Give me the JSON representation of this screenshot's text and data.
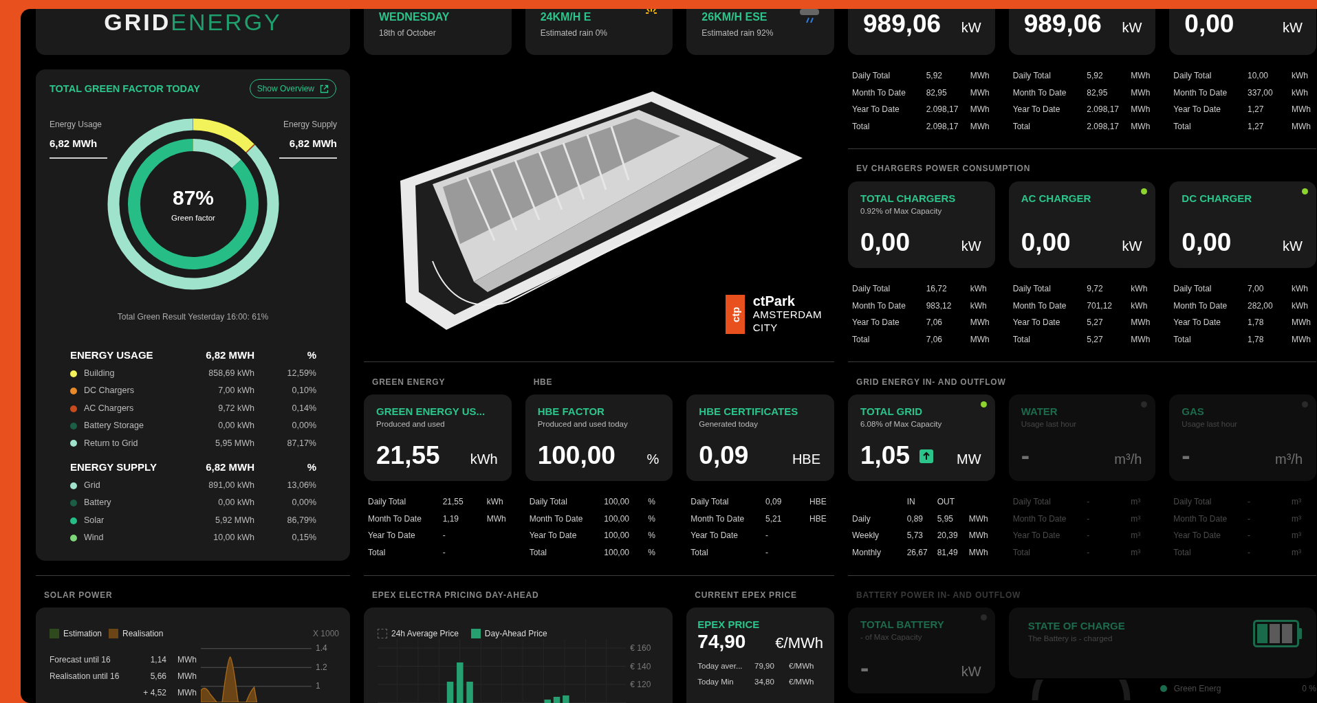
{
  "logo": {
    "part1": "GRID",
    "part2": "ENERGY"
  },
  "green_factor": {
    "title": "TOTAL GREEN FACTOR TODAY",
    "button": "Show Overview",
    "usage_label": "Energy Usage",
    "usage_value": "6,82 MWh",
    "supply_label": "Energy Supply",
    "supply_value": "6,82 MWh",
    "percent": "87%",
    "percent_label": "Green factor",
    "footnote": "Total Green Result Yesterday 16:00: 61%",
    "usage": {
      "heading": "ENERGY USAGE",
      "total": "6,82 MWH",
      "percent_heading": "%",
      "items": [
        {
          "name": "Building",
          "value": "858,69 kWh",
          "percent": "12,59%",
          "color": "#f2f25a"
        },
        {
          "name": "DC Chargers",
          "value": "7,00 kWh",
          "percent": "0,10%",
          "color": "#e88a2a"
        },
        {
          "name": "AC Chargers",
          "value": "9,72 kWh",
          "percent": "0,14%",
          "color": "#c84b1e"
        },
        {
          "name": "Battery Storage",
          "value": "0,00 kWh",
          "percent": "0,00%",
          "color": "#1a5e45"
        },
        {
          "name": "Return to Grid",
          "value": "5,95 MWh",
          "percent": "87,17%",
          "color": "#a0e3cc"
        }
      ]
    },
    "supply": {
      "heading": "ENERGY SUPPLY",
      "total": "6,82 MWH",
      "percent_heading": "%",
      "items": [
        {
          "name": "Grid",
          "value": "891,00 kWh",
          "percent": "13,06%",
          "color": "#a0e3cc"
        },
        {
          "name": "Battery",
          "value": "0,00 kWh",
          "percent": "0,00%",
          "color": "#1a5e45"
        },
        {
          "name": "Solar",
          "value": "5,92 MWh",
          "percent": "86,79%",
          "color": "#26bd87"
        },
        {
          "name": "Wind",
          "value": "10,00 kWh",
          "percent": "0,15%",
          "color": "#7ed67a"
        }
      ]
    }
  },
  "solar": {
    "title": "SOLAR POWER",
    "legend": [
      {
        "label": "Estimation",
        "color": "#2f4a1c"
      },
      {
        "label": "Realisation",
        "color": "#6b4516"
      }
    ],
    "scale": "X 1000",
    "ticks": [
      "1.4",
      "1.2",
      "1"
    ],
    "rows": [
      {
        "label": "Forecast until 16",
        "value": "1,14",
        "unit": "MWh"
      },
      {
        "label": "Realisation until 16",
        "value": "5,66",
        "unit": "MWh"
      },
      {
        "value": "+ 4,52",
        "unit": "MWh"
      }
    ]
  },
  "weather": [
    {
      "kind": "date",
      "title": "WEDNESDAY",
      "subtitle": "18th of October"
    },
    {
      "kind": "sun",
      "title": "24KM/H E",
      "subtitle": "Estimated rain 0%"
    },
    {
      "kind": "rain",
      "title": "26KM/H ESE",
      "subtitle": "Estimated rain 92%"
    }
  ],
  "building": {
    "mark": "ctp",
    "name": "ctPark",
    "lines": [
      "AMSTERDAM",
      "CITY"
    ]
  },
  "top_meters": [
    {
      "value": "989,06",
      "unit": "kW",
      "stats": [
        {
          "label": "Daily Total",
          "value": "5,92",
          "unit": "MWh"
        },
        {
          "label": "Month To Date",
          "value": "82,95",
          "unit": "MWh"
        },
        {
          "label": "Year To Date",
          "value": "2.098,17",
          "unit": "MWh"
        },
        {
          "label": "Total",
          "value": "2.098,17",
          "unit": "MWh"
        }
      ]
    },
    {
      "value": "989,06",
      "unit": "kW",
      "stats": [
        {
          "label": "Daily Total",
          "value": "5,92",
          "unit": "MWh"
        },
        {
          "label": "Month To Date",
          "value": "82,95",
          "unit": "MWh"
        },
        {
          "label": "Year To Date",
          "value": "2.098,17",
          "unit": "MWh"
        },
        {
          "label": "Total",
          "value": "2.098,17",
          "unit": "MWh"
        }
      ]
    },
    {
      "value": "0,00",
      "unit": "kW",
      "stats": [
        {
          "label": "Daily Total",
          "value": "10,00",
          "unit": "kWh"
        },
        {
          "label": "Month To Date",
          "value": "337,00",
          "unit": "kWh"
        },
        {
          "label": "Year To Date",
          "value": "1,27",
          "unit": "MWh"
        },
        {
          "label": "Total",
          "value": "1,27",
          "unit": "MWh"
        }
      ]
    }
  ],
  "ev_chargers": {
    "title": "EV CHARGERS POWER CONSUMPTION",
    "cards": [
      {
        "title": "TOTAL CHARGERS",
        "subtitle": "0.92% of Max Capacity",
        "value": "0,00",
        "unit": "kW",
        "stats": [
          {
            "label": "Daily Total",
            "value": "16,72",
            "unit": "kWh"
          },
          {
            "label": "Month To Date",
            "value": "983,12",
            "unit": "kWh"
          },
          {
            "label": "Year To Date",
            "value": "7,06",
            "unit": "MWh"
          },
          {
            "label": "Total",
            "value": "7,06",
            "unit": "MWh"
          }
        ]
      },
      {
        "title": "AC CHARGER",
        "value": "0,00",
        "unit": "kW",
        "online": true,
        "stats": [
          {
            "label": "Daily Total",
            "value": "9,72",
            "unit": "kWh"
          },
          {
            "label": "Month To Date",
            "value": "701,12",
            "unit": "kWh"
          },
          {
            "label": "Year To Date",
            "value": "5,27",
            "unit": "MWh"
          },
          {
            "label": "Total",
            "value": "5,27",
            "unit": "MWh"
          }
        ]
      },
      {
        "title": "DC CHARGER",
        "value": "0,00",
        "unit": "kW",
        "online": true,
        "stats": [
          {
            "label": "Daily Total",
            "value": "7,00",
            "unit": "kWh"
          },
          {
            "label": "Month To Date",
            "value": "282,00",
            "unit": "kWh"
          },
          {
            "label": "Year To Date",
            "value": "1,78",
            "unit": "MWh"
          },
          {
            "label": "Total",
            "value": "1,78",
            "unit": "MWh"
          }
        ]
      }
    ]
  },
  "middle_groups": [
    {
      "title": "GREEN ENERGY",
      "cards": [
        {
          "title": "GREEN ENERGY US...",
          "subtitle": "Produced and used",
          "value": "21,55",
          "unit": "kWh",
          "stats": [
            {
              "label": "Daily Total",
              "value": "21,55",
              "unit": "kWh"
            },
            {
              "label": "Month To Date",
              "value": "1,19",
              "unit": "MWh"
            },
            {
              "label": "Year To Date",
              "value": "-"
            },
            {
              "label": "Total",
              "value": "-"
            }
          ]
        }
      ]
    },
    {
      "title": "HBE",
      "cards": [
        {
          "title": "HBE FACTOR",
          "subtitle": "Produced and used today",
          "value": "100,00",
          "unit": "%",
          "stats": [
            {
              "label": "Daily Total",
              "value": "100,00",
              "unit": "%"
            },
            {
              "label": "Month To Date",
              "value": "100,00",
              "unit": "%"
            },
            {
              "label": "Year To Date",
              "value": "100,00",
              "unit": "%"
            },
            {
              "label": "Total",
              "value": "100,00",
              "unit": "%"
            }
          ]
        },
        {
          "title": "HBE CERTIFICATES",
          "subtitle": "Generated today",
          "value": "0,09",
          "unit": "HBE",
          "stats": [
            {
              "label": "Daily Total",
              "value": "0,09",
              "unit": "HBE"
            },
            {
              "label": "Month To Date",
              "value": "5,21",
              "unit": "HBE"
            },
            {
              "label": "Year To Date",
              "value": "-"
            },
            {
              "label": "Total",
              "value": "-"
            }
          ]
        }
      ]
    }
  ],
  "grid_flow": {
    "title": "GRID ENERGY IN- AND OUTFLOW",
    "cards": [
      {
        "title": "TOTAL GRID",
        "subtitle": "6.08% of Max Capacity",
        "value": "1,05",
        "trend_up": true,
        "unit": "MW",
        "online": true,
        "disabled": false,
        "table": {
          "header": [
            "IN",
            "OUT"
          ],
          "rows": [
            {
              "label": "Daily",
              "values": [
                "0,89",
                "5,95"
              ],
              "unit": "MWh"
            },
            {
              "label": "Weekly",
              "values": [
                "5,73",
                "20,39"
              ],
              "unit": "MWh"
            },
            {
              "label": "Monthly",
              "values": [
                "26,67",
                "81,49"
              ],
              "unit": "MWh"
            }
          ]
        }
      },
      {
        "title": "WATER",
        "subtitle": "Usage last hour",
        "value": "-",
        "unit": "m³/h",
        "online": false,
        "disabled": true,
        "stats": [
          {
            "label": "Daily Total",
            "value": "-",
            "unit": "m³"
          },
          {
            "label": "Month To Date",
            "value": "-",
            "unit": "m³"
          },
          {
            "label": "Year To Date",
            "value": "-",
            "unit": "m³"
          },
          {
            "label": "Total",
            "value": "-",
            "unit": "m³"
          }
        ]
      },
      {
        "title": "GAS",
        "subtitle": "Usage last hour",
        "value": "-",
        "unit": "m³/h",
        "online": false,
        "disabled": true,
        "stats": [
          {
            "label": "Daily Total",
            "value": "-",
            "unit": "m³"
          },
          {
            "label": "Month To Date",
            "value": "-",
            "unit": "m³"
          },
          {
            "label": "Year To Date",
            "value": "-",
            "unit": "m³"
          },
          {
            "label": "Total",
            "value": "-",
            "unit": "m³"
          }
        ]
      }
    ]
  },
  "epex_chart": {
    "title": "EPEX ELECTRA PRICING DAY-AHEAD",
    "legend": [
      {
        "kind": "dashed",
        "label": "24h Average Price"
      },
      {
        "kind": "solid",
        "label": "Day-Ahead Price"
      }
    ],
    "ticks": [
      "€ 160",
      "€ 140",
      "€ 120"
    ]
  },
  "epex_current": {
    "title": "CURRENT EPEX PRICE",
    "card_title": "EPEX PRICE",
    "value": "74,90",
    "unit": "€/MWh",
    "rows": [
      {
        "label": "Today aver...",
        "value": "79,90",
        "unit": "€/MWh"
      },
      {
        "label": "Today Min",
        "value": "34,80",
        "unit": "€/MWh"
      }
    ]
  },
  "battery": {
    "title": "BATTERY POWER IN- AND OUTFLOW",
    "disabled": true,
    "total": {
      "title": "TOTAL BATTERY",
      "subtitle": "- of Max Capacity",
      "value": "-",
      "unit": "kW",
      "online": false,
      "disabled": true
    },
    "charge": {
      "title": "STATE OF CHARGE",
      "subtitle": "The Battery is - charged",
      "legend": [
        {
          "label": "Green Energ",
          "value": "0 %",
          "color": "#1a6b4c"
        }
      ]
    }
  }
}
